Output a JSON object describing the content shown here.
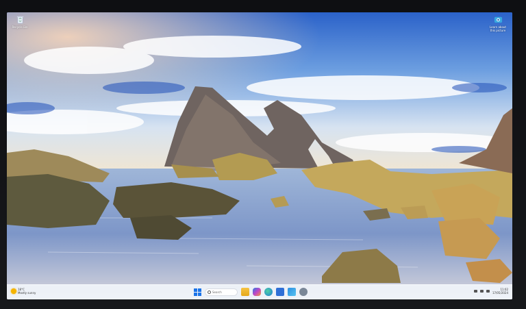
{
  "desktop": {
    "icons": [
      {
        "label": "Recycle Bin",
        "icon": "recycle-bin-icon"
      },
      {
        "label": "Learn about this picture",
        "icon": "camera-icon"
      }
    ]
  },
  "taskbar": {
    "weather": {
      "temperature": "18°C",
      "condition": "Mostly sunny",
      "icon": "sun-icon"
    },
    "search_placeholder": "Search",
    "pinned_apps": [
      "start-icon",
      "search-box",
      "file-explorer-icon",
      "copilot-icon",
      "edge-icon",
      "store-icon",
      "photos-icon",
      "settings-icon"
    ],
    "tray": {
      "time": "11:02",
      "date": "17/05/2024"
    }
  },
  "colors": {
    "taskbar_bg": "#eef2f8",
    "accent": "#1a73e8"
  }
}
